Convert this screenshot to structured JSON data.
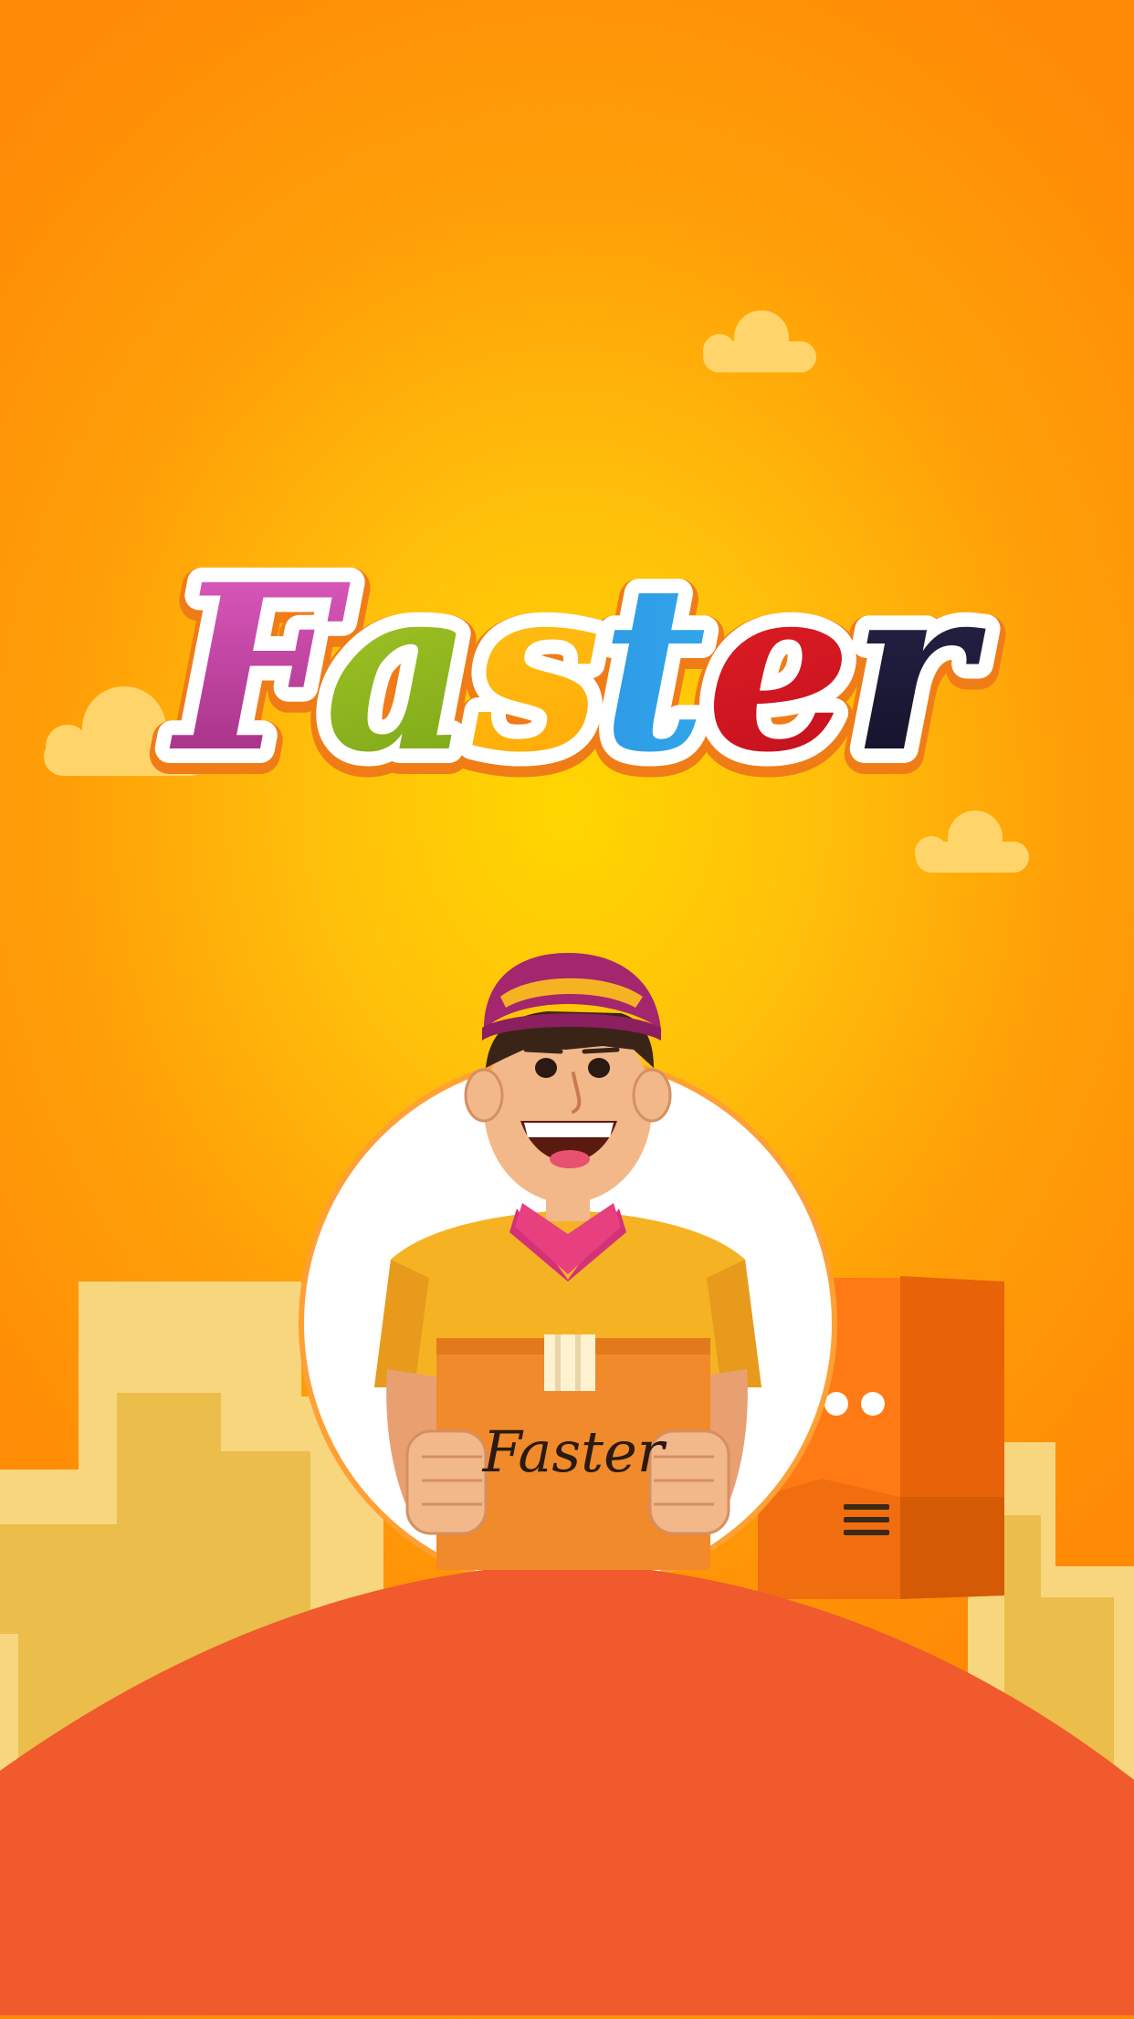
{
  "app": {
    "logo_text": "Faster",
    "box_label": "Faster"
  },
  "icons": {
    "cloud": "cloud-icon",
    "menu": "menu-icon"
  },
  "colors": {
    "background_center": "#ffd600",
    "background_edge": "#ff8a06",
    "hill": "#f05a2d",
    "buildings_light": "#f7d67e",
    "buildings_dark": "#ebbd4a",
    "logo_letters": [
      "#b8318f",
      "#8bbd18",
      "#ffb300",
      "#2196f3",
      "#e01422",
      "#1a1838"
    ]
  }
}
